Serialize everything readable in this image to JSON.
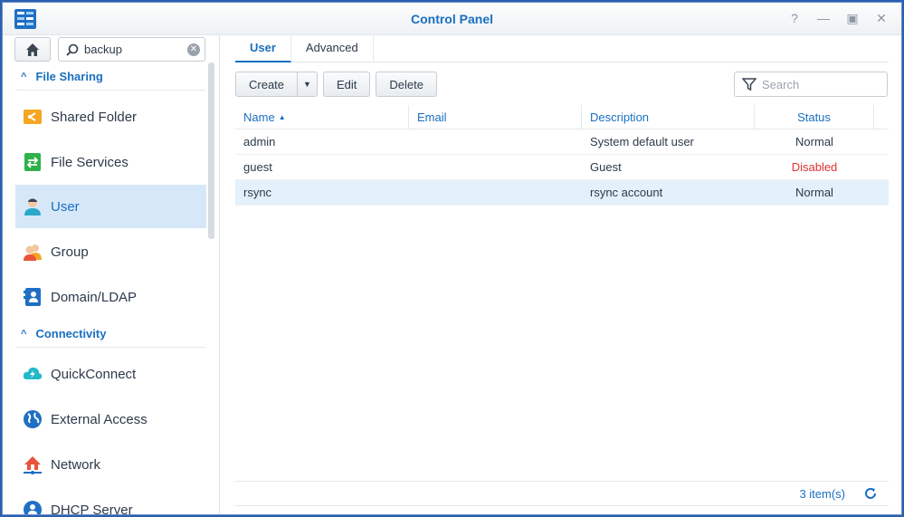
{
  "window": {
    "title": "Control Panel"
  },
  "sidebar": {
    "search_value": "backup",
    "sections": [
      {
        "label": "File Sharing"
      },
      {
        "label": "Connectivity"
      }
    ],
    "items": [
      {
        "label": "Shared Folder",
        "icon": "shared-folder-icon",
        "color": "#f5a623"
      },
      {
        "label": "File Services",
        "icon": "file-services-icon",
        "color": "#2fb14a"
      },
      {
        "label": "User",
        "icon": "user-icon",
        "color": "#2aa9c9"
      },
      {
        "label": "Group",
        "icon": "group-icon",
        "color": "#e8533b"
      },
      {
        "label": "Domain/LDAP",
        "icon": "domain-ldap-icon",
        "color": "#1f6fc4"
      },
      {
        "label": "QuickConnect",
        "icon": "quickconnect-icon",
        "color": "#22b8c9"
      },
      {
        "label": "External Access",
        "icon": "external-access-icon",
        "color": "#1f6fc4"
      },
      {
        "label": "Network",
        "icon": "network-icon",
        "color": "#e8533b"
      },
      {
        "label": "DHCP Server",
        "icon": "dhcp-server-icon",
        "color": "#1f6fc4"
      }
    ]
  },
  "main": {
    "tabs": [
      {
        "label": "User"
      },
      {
        "label": "Advanced"
      }
    ],
    "toolbar": {
      "create": "Create",
      "edit": "Edit",
      "delete": "Delete",
      "search_placeholder": "Search"
    },
    "columns": {
      "name": "Name",
      "email": "Email",
      "description": "Description",
      "status": "Status"
    },
    "rows": [
      {
        "name": "admin",
        "email": "",
        "description": "System default user",
        "status": "Normal"
      },
      {
        "name": "guest",
        "email": "",
        "description": "Guest",
        "status": "Disabled"
      },
      {
        "name": "rsync",
        "email": "",
        "description": "rsync account",
        "status": "Normal"
      }
    ],
    "footer": {
      "count": "3 item(s)"
    }
  },
  "colors": {
    "accent": "#1a6fc2",
    "selected_bg": "#d6e8f8",
    "disabled": "#e03131"
  }
}
